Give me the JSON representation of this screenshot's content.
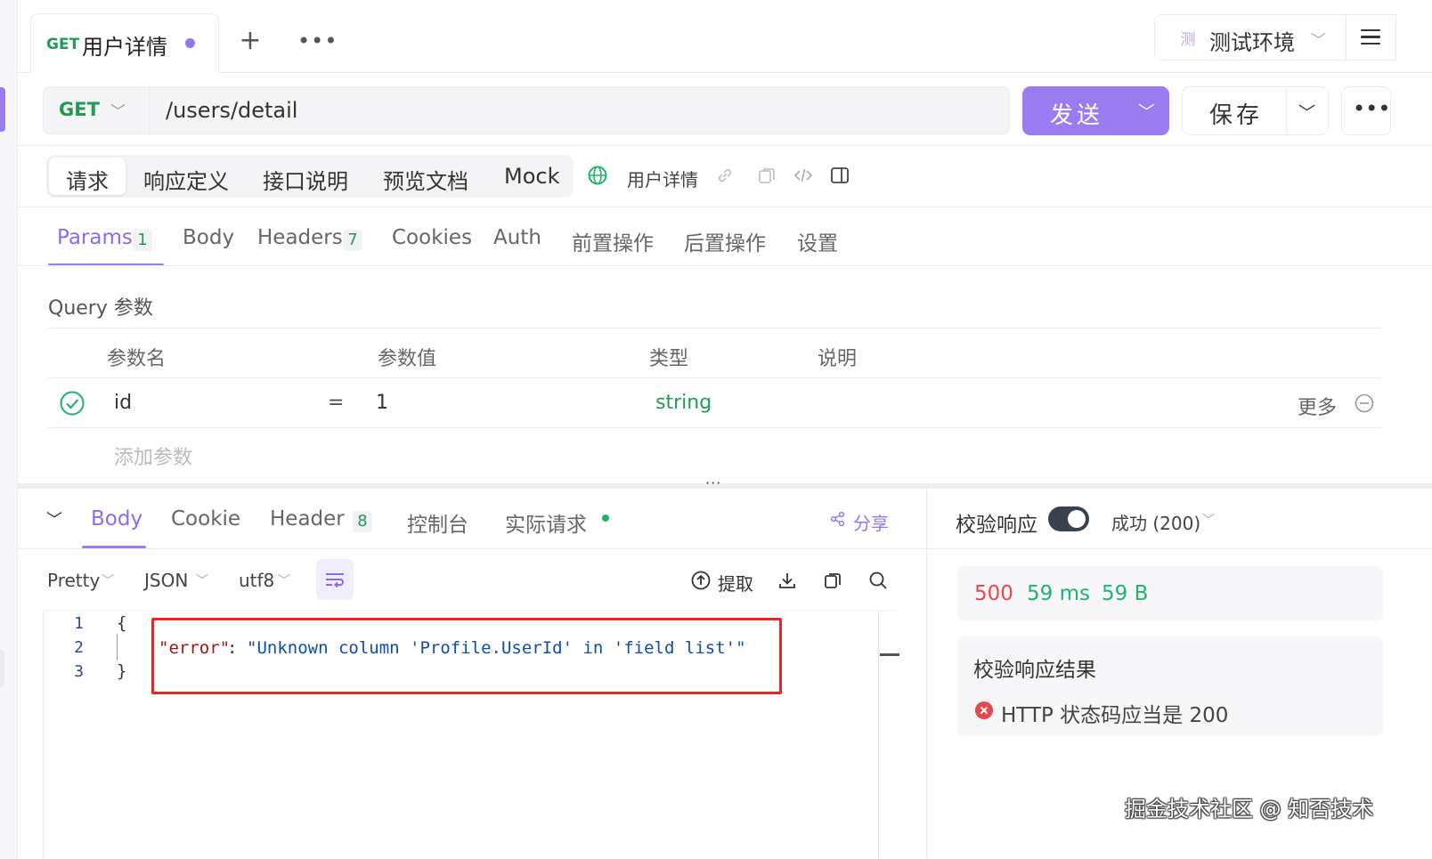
{
  "tab": {
    "method": "GET",
    "title": "用户详情",
    "add_icon": "plus-icon",
    "more_icon": "ellipsis-icon"
  },
  "env": {
    "badge": "测",
    "label": "测试环境"
  },
  "request": {
    "method": "GET",
    "url": "/users/detail",
    "send_label": "发送",
    "save_label": "保存"
  },
  "seg_tabs": [
    "请求",
    "响应定义",
    "接口说明",
    "预览文档",
    "Mock"
  ],
  "api_name": "用户详情",
  "sub_tabs": [
    {
      "label": "Params",
      "badge": "1"
    },
    {
      "label": "Body"
    },
    {
      "label": "Headers",
      "badge": "7"
    },
    {
      "label": "Cookies"
    },
    {
      "label": "Auth"
    },
    {
      "label": "前置操作"
    },
    {
      "label": "后置操作"
    },
    {
      "label": "设置"
    }
  ],
  "query": {
    "title": "Query 参数",
    "columns": [
      "参数名",
      "参数值",
      "类型",
      "说明"
    ],
    "rows": [
      {
        "key": "id",
        "eq": "=",
        "value": "1",
        "type": "string",
        "more": "更多"
      }
    ],
    "add_placeholder": "添加参数"
  },
  "splitter_dots": "···",
  "response_tabs": [
    {
      "label": "Body"
    },
    {
      "label": "Cookie"
    },
    {
      "label": "Header",
      "badge": "8"
    },
    {
      "label": "控制台"
    },
    {
      "label": "实际请求"
    }
  ],
  "share_label": "分享",
  "format": {
    "view": "Pretty",
    "type": "JSON",
    "encoding": "utf8"
  },
  "extract_label": "提取",
  "code": {
    "line_numbers": [
      "1",
      "2",
      "3"
    ],
    "open": "{",
    "key": "\"error\"",
    "colon": ":",
    "value": "\"Unknown column 'Profile.UserId' in 'field list'\"",
    "close": "}"
  },
  "validation": {
    "label": "校验响应",
    "enabled": true,
    "status_option": "成功 (200)",
    "metrics": {
      "status": "500",
      "time": "59 ms",
      "size": "59 B"
    },
    "result_title": "校验响应结果",
    "result_text": "HTTP 状态码应当是 200",
    "colors": {
      "error": "#e5484d",
      "ok": "#1fb36b",
      "accent": "#9b7bf0"
    }
  },
  "watermark": "掘金技术社区 @ 知否技术"
}
